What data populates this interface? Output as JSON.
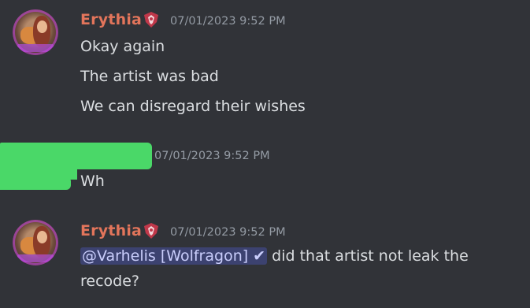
{
  "messages": [
    {
      "username": "Erythia",
      "timestamp": "07/01/2023 9:52 PM",
      "lines": [
        "Okay again",
        "The artist was bad",
        "We can disregard their wishes"
      ]
    },
    {
      "username": "",
      "timestamp": "07/01/2023 9:52 PM",
      "lines": [
        "Wh"
      ]
    },
    {
      "username": "Erythia",
      "timestamp": "07/01/2023 9:52 PM",
      "mention": "@Varhelis [Wolfragon] ✔",
      "text_after_mention": " did that artist not leak the",
      "text_line2": "recode?"
    }
  ],
  "colors": {
    "background": "#313338",
    "username": "#e3755b",
    "timestamp": "#949ba4",
    "text": "#dbdee1",
    "redaction": "#4ad868",
    "mention_bg": "#3c4270"
  },
  "icons": {
    "role_badge": "crest-icon"
  }
}
